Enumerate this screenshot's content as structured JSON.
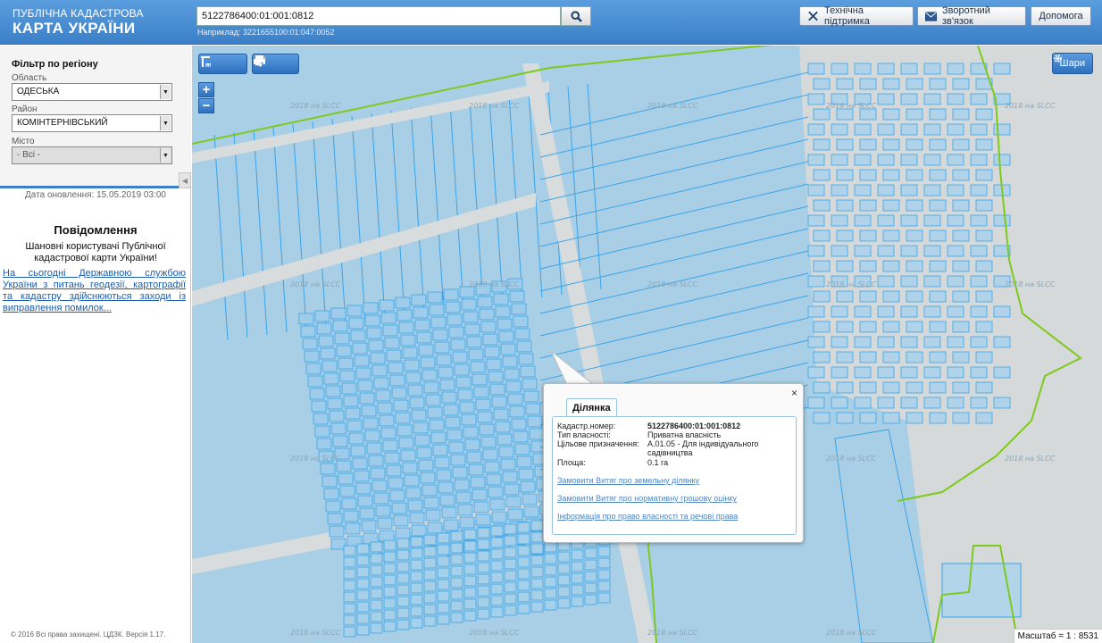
{
  "header": {
    "logo_line1": "ПУБЛІЧНА КАДАСТРОВА",
    "logo_line2": "КАРТА УКРАЇНИ",
    "search_value": "5122786400:01:001:0812",
    "example": "Наприклад: 3221655100:01:047:0052",
    "buttons": {
      "support": "Технічна підтримка",
      "feedback": "Зворотний зв'язок",
      "help": "Допомога"
    }
  },
  "sidebar": {
    "filter_title": "Фільтр по регіону",
    "region_label": "Область",
    "region_value": "ОДЕСЬКА",
    "district_label": "Район",
    "district_value": "КОМІНТЕРНІВСЬКИЙ",
    "city_label": "Місто",
    "city_value": "- Всі -",
    "update_text": "Дата оновлення: 15.05.2019 03:00",
    "notice_title": "Повідомлення",
    "notice_text": "Шановні користувачі Публічної кадастрової карти України!",
    "notice_link": "На сьогодні Державною службою України з питань геодезії, картографії та кадастру здійснюються заходи із виправлення помилок...",
    "copyright": "© 2016 Всі права захищені. ЦДЗК. Версія 1.17."
  },
  "map": {
    "layers_button": "Шари",
    "zoom_in": "+",
    "zoom_out": "−",
    "scale_text": "Масштаб = 1 : 8531",
    "watermark": "2018 на SLCC",
    "tools": [
      "ruler-icon",
      "area-measure-icon",
      "print-icon",
      "identify-icon"
    ],
    "colors": {
      "parcel_fill": "#a9cfe6",
      "parcel_stroke": "#3aa3e6",
      "road": "#d9dcdc",
      "boundary": "#7ec91e"
    }
  },
  "popup": {
    "tab_label": "Ділянка",
    "close": "×",
    "rows": [
      {
        "key": "Кадастр.номер:",
        "value": "5122786400:01:001:0812"
      },
      {
        "key": "Тип власності:",
        "value": "Приватна власність"
      },
      {
        "key": "Цільове призначення:",
        "value": "А.01.05 - Для індивідуального садівництва"
      },
      {
        "key": "Площа:",
        "value": "0.1 га"
      }
    ],
    "links": [
      "Замовити Витяг про земельну ділянку",
      "Замовити Витяг про нормативну грошову оцінку",
      "Інформація про право власності та речові права"
    ]
  }
}
